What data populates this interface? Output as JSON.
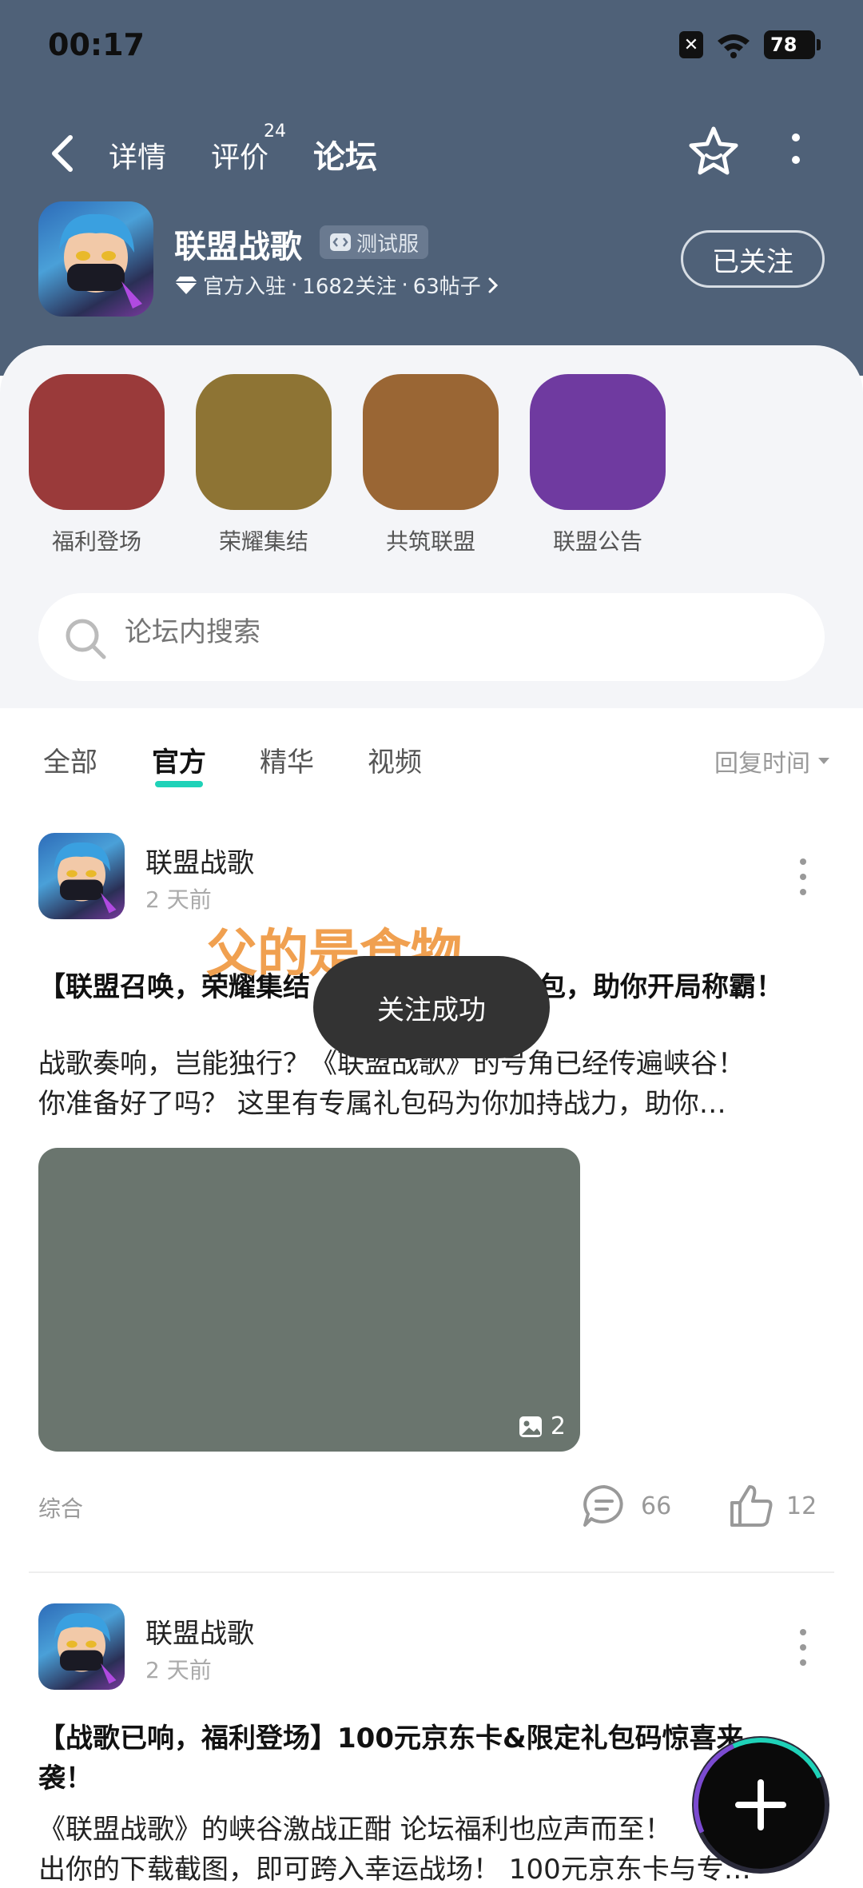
{
  "status_bar": {
    "time": "00:17",
    "battery": "78"
  },
  "nav": {
    "tabs": [
      {
        "label": "详情"
      },
      {
        "label": "评价",
        "badge": "24"
      },
      {
        "label": "论坛"
      }
    ],
    "active_tab": "论坛"
  },
  "app": {
    "name": "联盟战歌",
    "badge": "测试服",
    "official": "官方入驻",
    "follows": "1682关注",
    "posts": "63帖子",
    "follow_button": "已关注"
  },
  "quick_links": [
    {
      "label": "福利登场",
      "color": "#9a3a3a"
    },
    {
      "label": "荣耀集结",
      "color": "#8e7434"
    },
    {
      "label": "共筑联盟",
      "color": "#9a6634"
    },
    {
      "label": "联盟公告",
      "color": "#6f3aa0"
    }
  ],
  "search": {
    "placeholder": "论坛内搜索"
  },
  "filters": {
    "tabs": [
      {
        "label": "全部"
      },
      {
        "label": "官方"
      },
      {
        "label": "精华"
      },
      {
        "label": "视频"
      }
    ],
    "active": "官方",
    "sort_label": "回复时间"
  },
  "posts": [
    {
      "author": "联盟战歌",
      "time": "2 天前",
      "title": "【联盟召唤，荣耀集结…包，助你开局称霸！",
      "title_left": "【联盟召唤，荣耀集结",
      "title_right": "包，助你开局称霸！",
      "body_line1": "战歌奏响，岂能独行？《联盟战歌》的号角已经传遍峡谷！",
      "body_line2": "你准备好了吗？ 这里有专属礼包码为你加持战力，助你…",
      "image_count": "2",
      "tag": "综合",
      "comments": "66",
      "likes": "12"
    },
    {
      "author": "联盟战歌",
      "time": "2 天前",
      "title_line1": "【战歌已响，福利登场】100元京东卡&限定礼包码惊喜来",
      "title_line2": "袭！",
      "body_line1": "《联盟战歌》的峡谷激战正酣 论坛福利也应声而至！",
      "body_line2": "出你的下载截图，即可跨入幸运战场！ 100元京东卡与专…"
    }
  ],
  "overlay_text": "父的是食物",
  "toast": "关注成功"
}
